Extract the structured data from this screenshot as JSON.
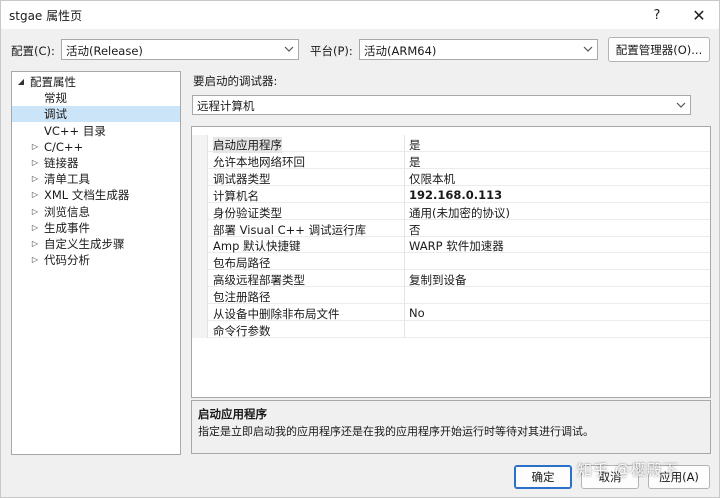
{
  "window": {
    "title": "stgae 属性页",
    "help": "?",
    "close": "✕"
  },
  "config": {
    "label": "配置(C):",
    "value": "活动(Release)"
  },
  "platform": {
    "label": "平台(P):",
    "value": "活动(ARM64)"
  },
  "config_manager_label": "配置管理器(O)...",
  "tree": {
    "items": [
      {
        "label": "配置属性",
        "expander": "◢",
        "selected": false
      },
      {
        "label": "常规",
        "expander": "",
        "selected": false
      },
      {
        "label": "调试",
        "expander": "",
        "selected": true
      },
      {
        "label": "VC++ 目录",
        "expander": "",
        "selected": false
      },
      {
        "label": "C/C++",
        "expander": "▷",
        "selected": false
      },
      {
        "label": "链接器",
        "expander": "▷",
        "selected": false
      },
      {
        "label": "清单工具",
        "expander": "▷",
        "selected": false
      },
      {
        "label": "XML 文档生成器",
        "expander": "▷",
        "selected": false
      },
      {
        "label": "浏览信息",
        "expander": "▷",
        "selected": false
      },
      {
        "label": "生成事件",
        "expander": "▷",
        "selected": false
      },
      {
        "label": "自定义生成步骤",
        "expander": "▷",
        "selected": false
      },
      {
        "label": "代码分析",
        "expander": "▷",
        "selected": false
      }
    ]
  },
  "debugger": {
    "label": "要启动的调试器:",
    "value": "远程计算机"
  },
  "properties": [
    {
      "name": "启动应用程序",
      "value": "是",
      "bold": false
    },
    {
      "name": "允许本地网络环回",
      "value": "是",
      "bold": false
    },
    {
      "name": "调试器类型",
      "value": "仅限本机",
      "bold": false
    },
    {
      "name": "计算机名",
      "value": "192.168.0.113",
      "bold": true
    },
    {
      "name": "身份验证类型",
      "value": "通用(未加密的协议)",
      "bold": false
    },
    {
      "name": "部署 Visual C++ 调试运行库",
      "value": "否",
      "bold": false
    },
    {
      "name": "Amp 默认快捷键",
      "value": "WARP 软件加速器",
      "bold": false
    },
    {
      "name": "包布局路径",
      "value": "",
      "bold": false
    },
    {
      "name": "高级远程部署类型",
      "value": "复制到设备",
      "bold": false
    },
    {
      "name": "包注册路径",
      "value": "",
      "bold": false
    },
    {
      "name": "从设备中删除非布局文件",
      "value": "No",
      "bold": false
    },
    {
      "name": "命令行参数",
      "value": "",
      "bold": false
    }
  ],
  "description": {
    "title": "启动应用程序",
    "text": "指定是立即启动我的应用程序还是在我的应用程序开始运行时等待对其进行调试。"
  },
  "buttons": {
    "ok": "确定",
    "cancel": "取消",
    "apply": "应用(A)"
  },
  "watermark": "知乎 @樱殿下",
  "icons": {
    "dropdown": "chevron-down-icon",
    "tree_expand": "triangle-right-icon",
    "tree_expanded": "triangle-down-icon"
  }
}
